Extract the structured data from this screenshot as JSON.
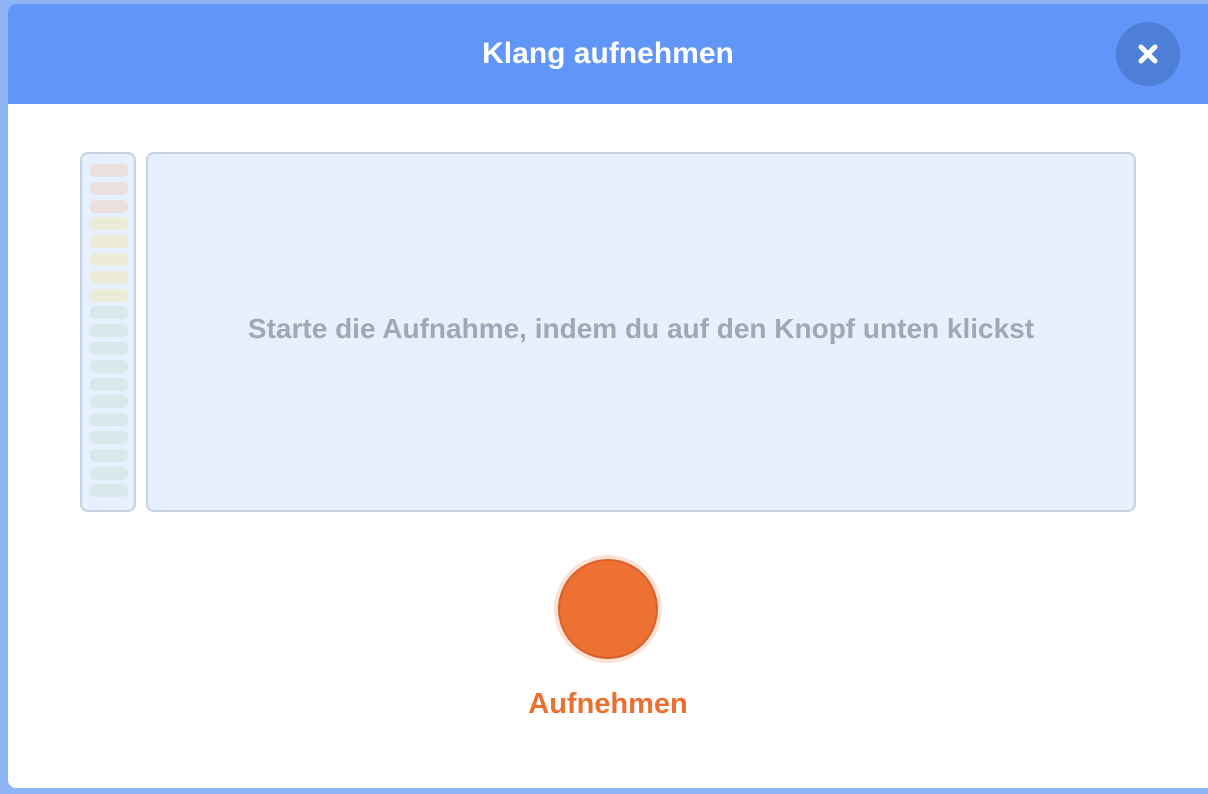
{
  "dialog": {
    "title": "Klang aufnehmen",
    "close_icon": "close-icon"
  },
  "recorder": {
    "instruction": "Starte die Aufnahme, indem du auf den Knopf unten klickst",
    "record_label": "Aufnehmen",
    "record_icon": "record-dot-icon",
    "level_meter": {
      "level": 0,
      "segment_count": 19,
      "segment_colors": [
        "#ecdfe0",
        "#ecdfe0",
        "#ecdfe0",
        "#ecebd8",
        "#ecebd8",
        "#ecebd8",
        "#ecebd8",
        "#ecebd8",
        "#d7e9ea",
        "#d7e9ea",
        "#d7e9ea",
        "#d7e9ea",
        "#d7e9ea",
        "#d7e9ea",
        "#d7e9ea",
        "#d7e9ea",
        "#d7e9ea",
        "#d7e9ea",
        "#d7e9ea"
      ]
    }
  },
  "colors": {
    "header": "#6195f7",
    "record": "#ee7134",
    "record_label": "#ec6f30",
    "panel": "#e6f0ff"
  }
}
